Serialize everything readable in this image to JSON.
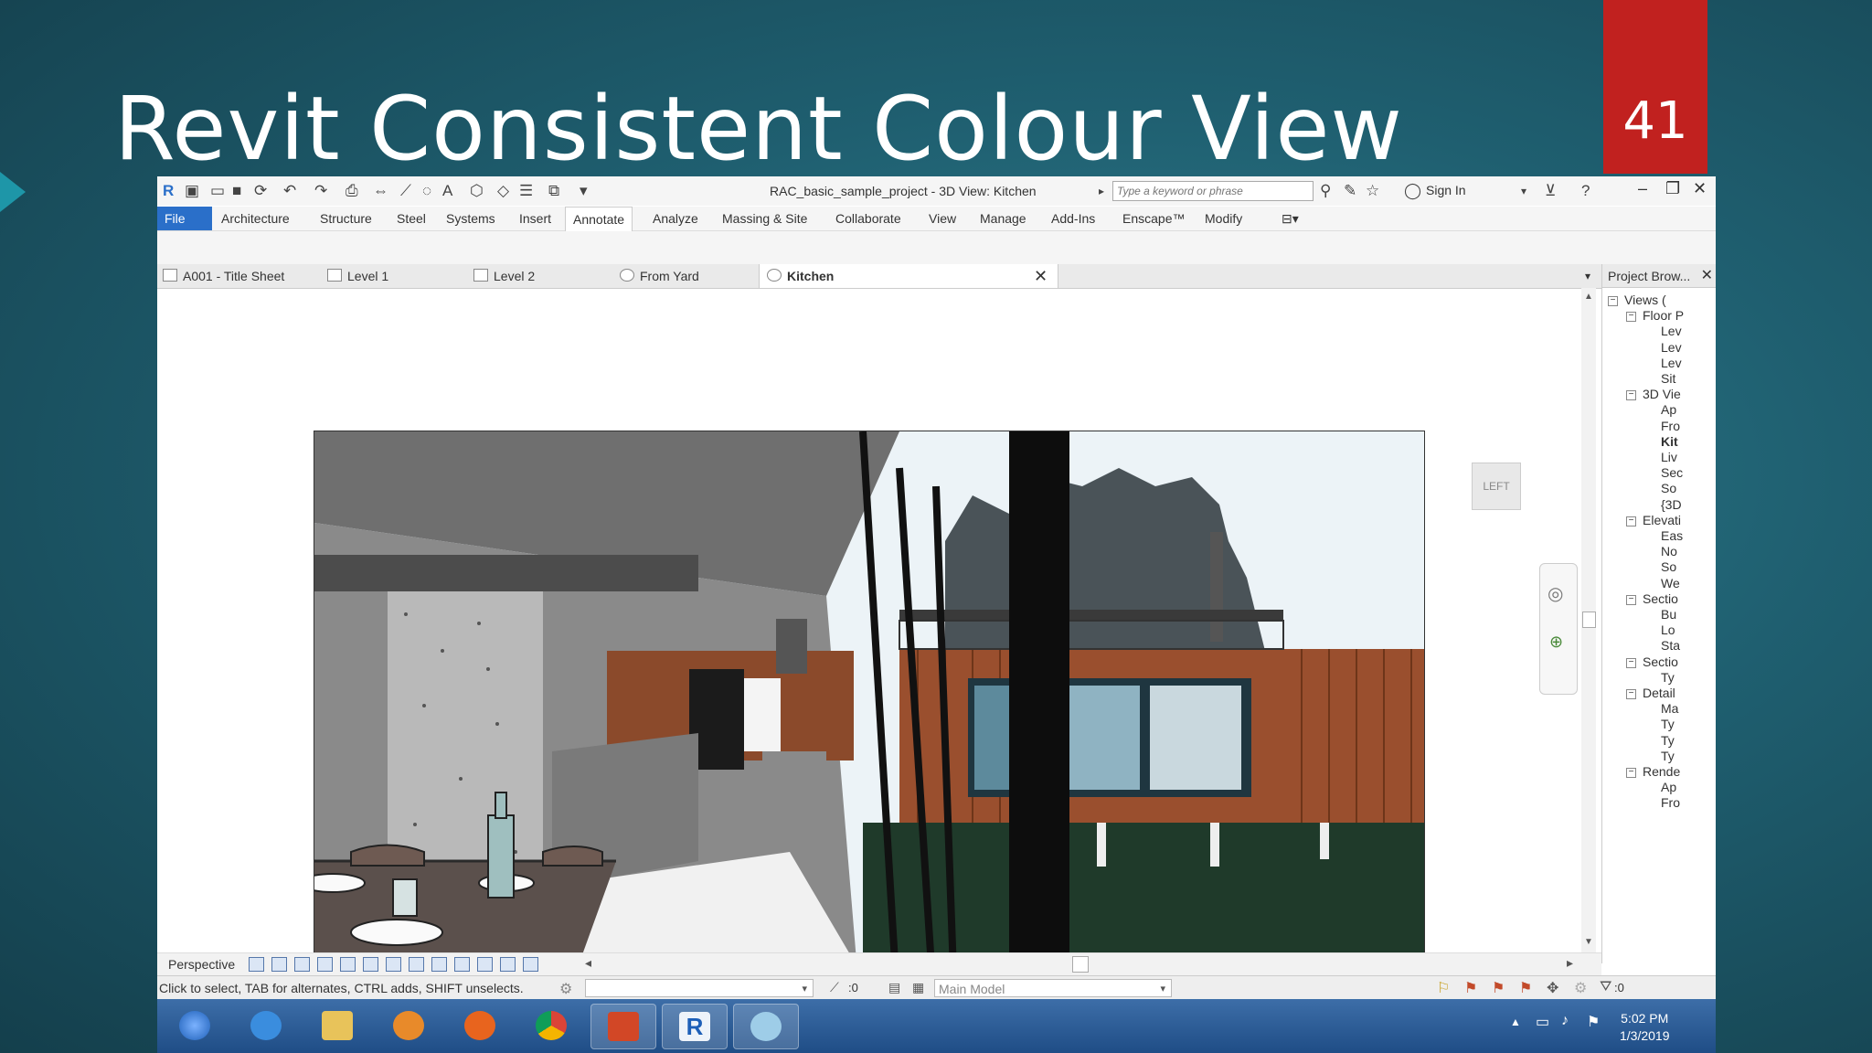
{
  "slide": {
    "title": "Revit Consistent Colour View",
    "number": "41"
  },
  "window": {
    "title": "RAC_basic_sample_project - 3D View: Kitchen",
    "search_placeholder": "Type a keyword or phrase",
    "sign_in": "Sign In"
  },
  "ribbon": {
    "tabs": [
      "File",
      "Architecture",
      "Structure",
      "Steel",
      "Systems",
      "Insert",
      "Annotate",
      "Analyze",
      "Massing & Site",
      "Collaborate",
      "View",
      "Manage",
      "Add-Ins",
      "Enscape™",
      "Modify"
    ],
    "active": "Annotate"
  },
  "doc_tabs": {
    "items": [
      "A001 - Title Sheet",
      "Level 1",
      "Level 2",
      "From Yard",
      "Kitchen"
    ],
    "active": "Kitchen"
  },
  "viewcube": {
    "face": "LEFT"
  },
  "project_browser": {
    "title": "Project Brow...",
    "items": [
      "Views (",
      "Floor P",
      "Lev",
      "Lev",
      "Lev",
      "Sit",
      "3D Vie",
      "Ap",
      "Fro",
      "Kit",
      "Liv",
      "Sec",
      "So",
      "{3D",
      "Elevati",
      "Eas",
      "No",
      "So",
      "We",
      "Sectio",
      "Bu",
      "Lo",
      "Sta",
      "Sectio",
      "Ty",
      "Detail",
      "Ma",
      "Ty",
      "Ty",
      "Ty",
      "Rende",
      "Ap",
      "Fro"
    ]
  },
  "view_control": {
    "mode": "Perspective"
  },
  "status_bar": {
    "hint": "Click to select, TAB for alternates, CTRL adds, SHIFT unselects.",
    "zero_a": ":0",
    "model": "Main Model",
    "zero_b": ":0"
  },
  "taskbar": {
    "time": "5:02 PM",
    "date": "1/3/2019"
  }
}
